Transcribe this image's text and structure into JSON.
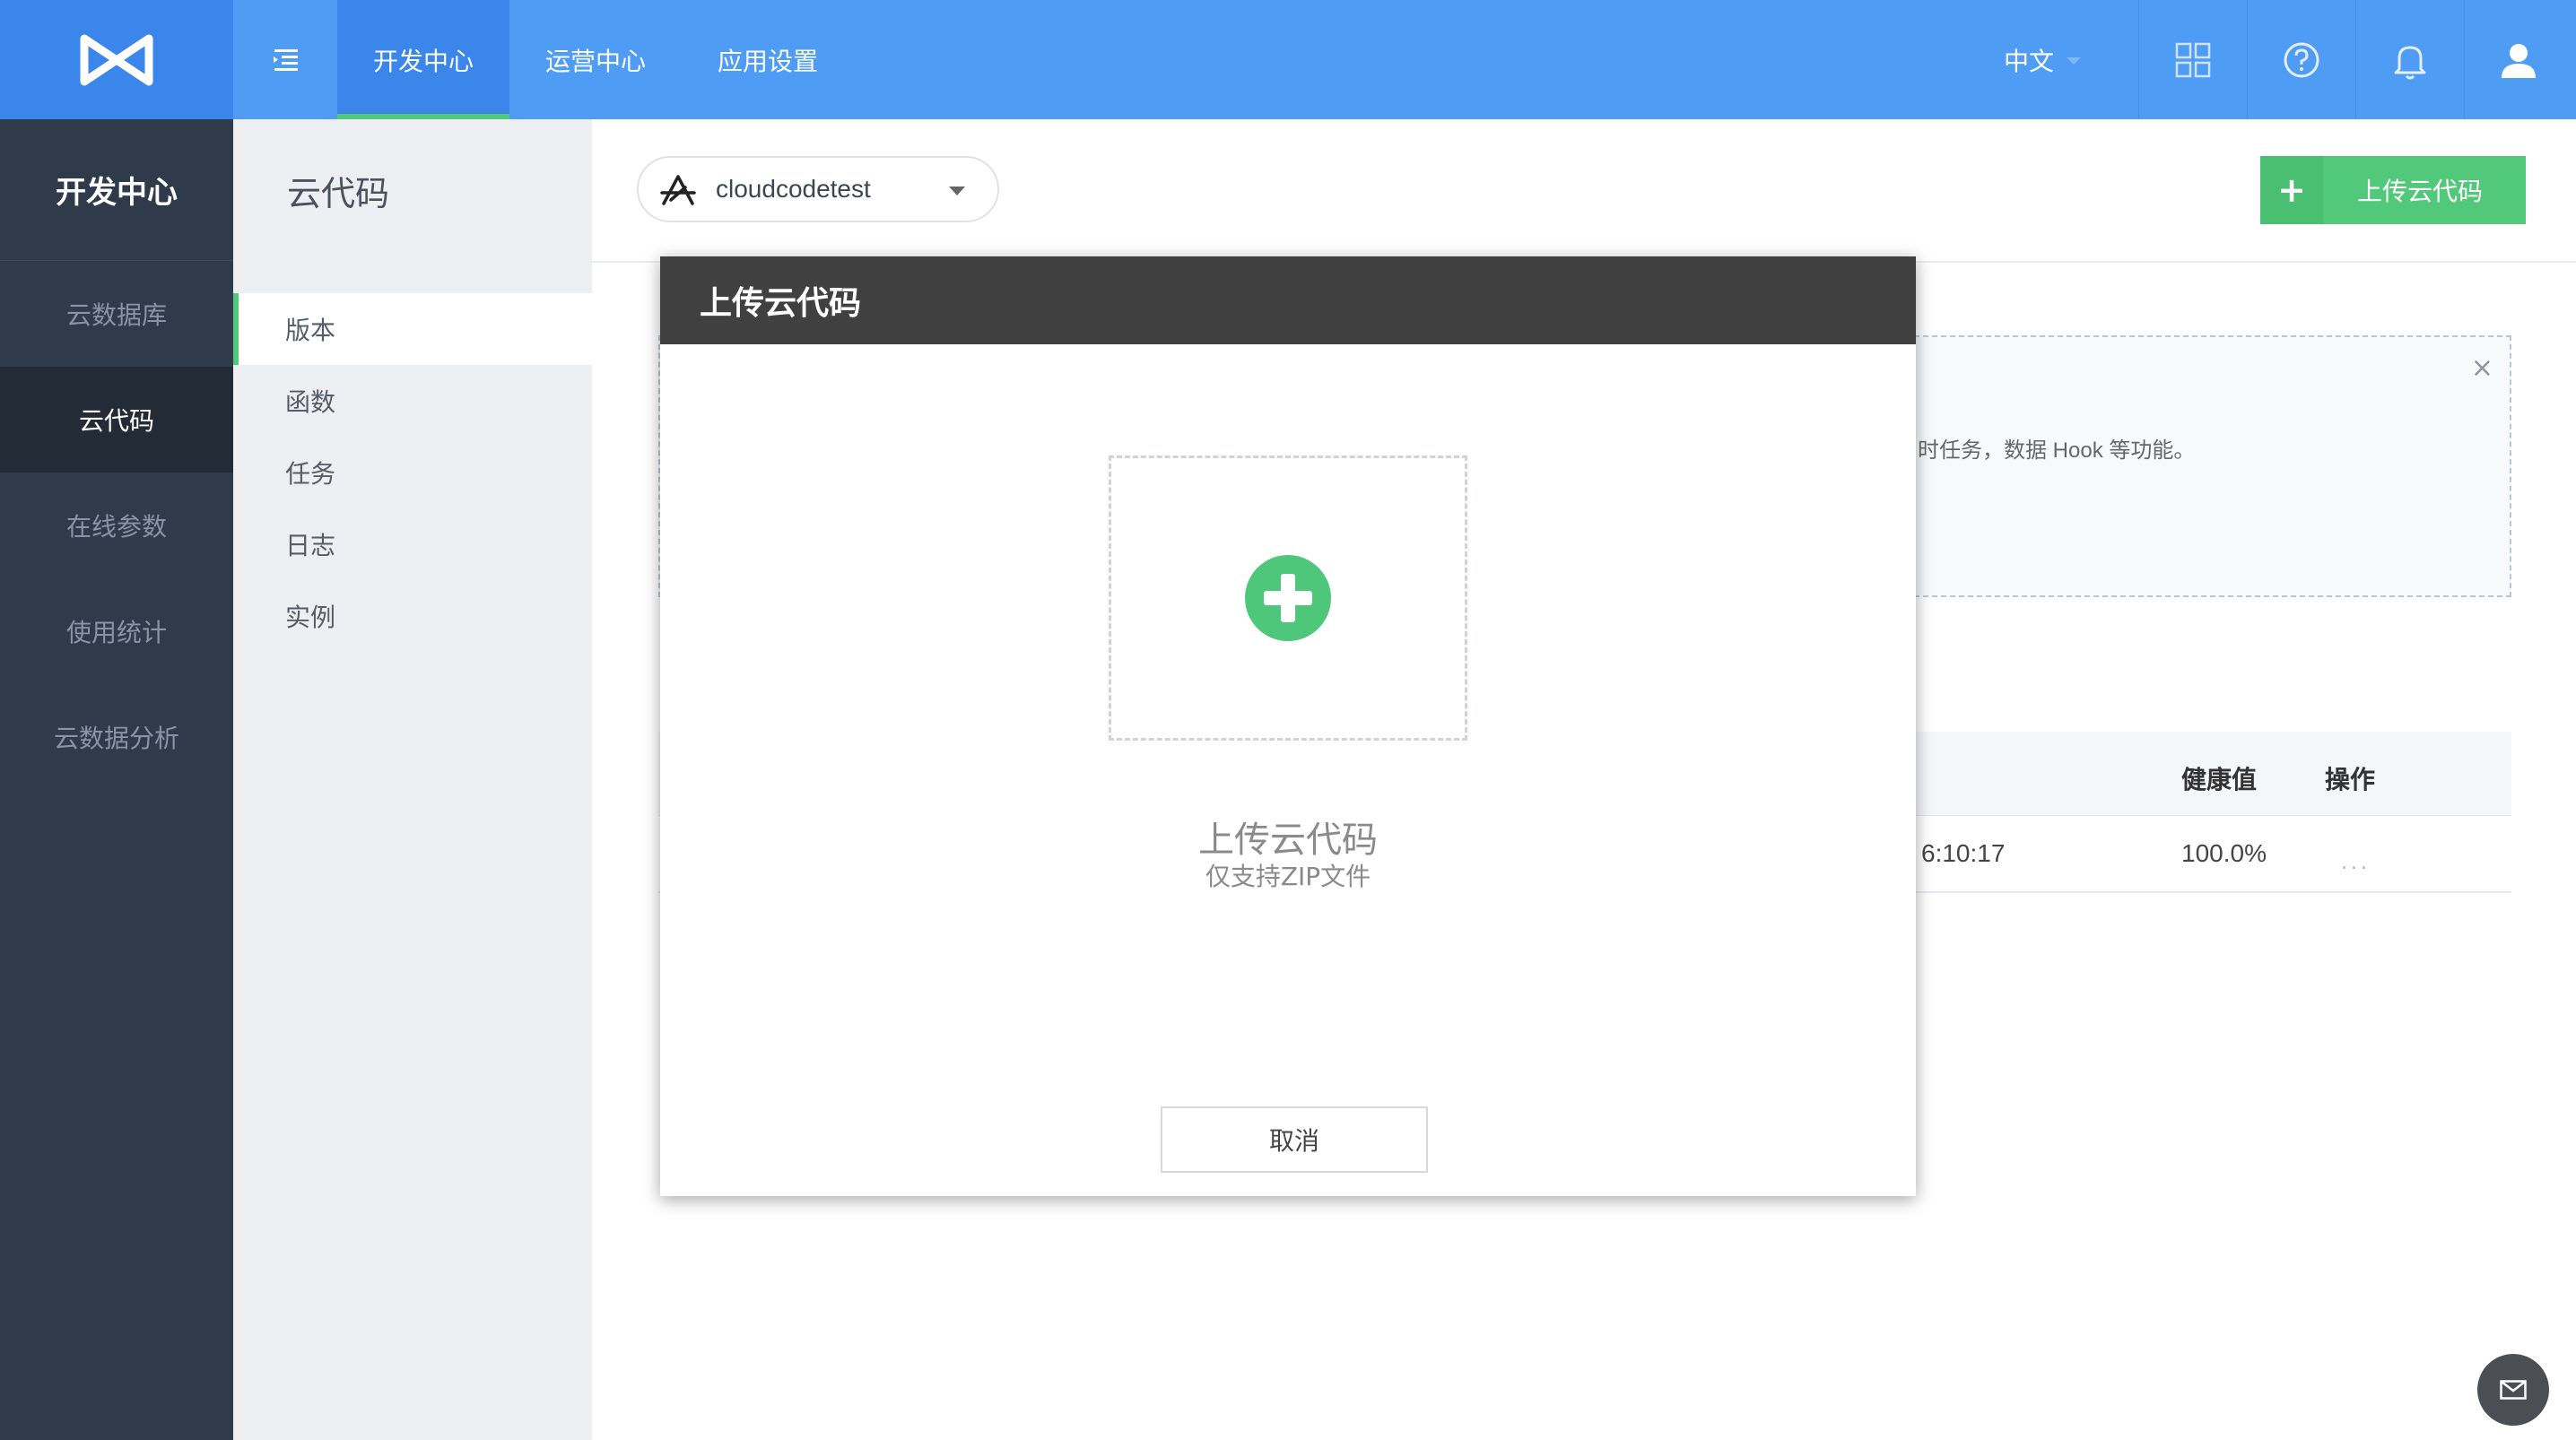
{
  "topbar": {
    "nav": [
      {
        "label": "开发中心",
        "active": true
      },
      {
        "label": "运营中心",
        "active": false
      },
      {
        "label": "应用设置",
        "active": false
      }
    ],
    "language": "中文"
  },
  "sidebar": {
    "title": "开发中心",
    "items": [
      {
        "label": "云数据库",
        "active": false
      },
      {
        "label": "云代码",
        "active": true
      },
      {
        "label": "在线参数",
        "active": false
      },
      {
        "label": "使用统计",
        "active": false
      },
      {
        "label": "云数据分析",
        "active": false
      }
    ]
  },
  "subnav": {
    "title": "云代码",
    "items": [
      {
        "label": "版本",
        "active": true
      },
      {
        "label": "函数",
        "active": false
      },
      {
        "label": "任务",
        "active": false
      },
      {
        "label": "日志",
        "active": false
      },
      {
        "label": "实例",
        "active": false
      }
    ]
  },
  "main": {
    "app_selector": {
      "value": "cloudcodetest"
    },
    "upload_button": {
      "plus": "+",
      "label": "上传云代码"
    },
    "notice": {
      "text": "时任务，数据 Hook 等功能。",
      "close": "×"
    },
    "table": {
      "headers": {
        "health": "健康值",
        "actions": "操作"
      },
      "rows": [
        {
          "time": "6:10:17",
          "health": "100.0%",
          "actions": "..."
        }
      ]
    }
  },
  "modal": {
    "title": "上传云代码",
    "dropzone_title": "上传云代码",
    "dropzone_hint": "仅支持ZIP文件",
    "cancel": "取消"
  },
  "colors": {
    "topbar": "#4f9cf5",
    "sidebar": "#2f3a4a",
    "accent_green": "#52c97a",
    "modal_header": "#404040"
  }
}
